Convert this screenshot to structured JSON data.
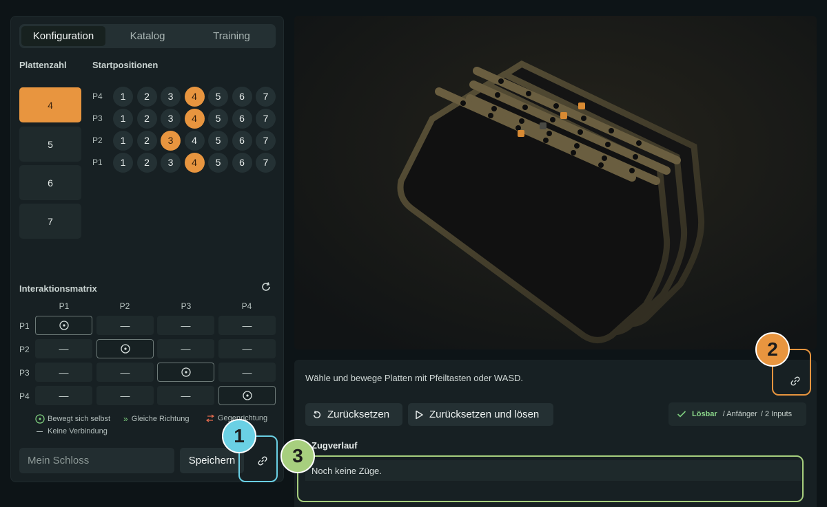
{
  "tabs": [
    "Konfiguration",
    "Katalog",
    "Training"
  ],
  "labels": {
    "plattenzahl": "Plattenzahl",
    "startpositionen": "Startpositionen",
    "interaktionsmatrix": "Interaktionsmatrix"
  },
  "plattenzahl": {
    "options": [
      "4",
      "5",
      "6",
      "7"
    ],
    "selected": "4"
  },
  "startpositionen": {
    "rows": [
      {
        "label": "P4",
        "values": [
          "1",
          "2",
          "3",
          "4",
          "5",
          "6",
          "7"
        ],
        "active": "4"
      },
      {
        "label": "P3",
        "values": [
          "1",
          "2",
          "3",
          "4",
          "5",
          "6",
          "7"
        ],
        "active": "4"
      },
      {
        "label": "P2",
        "values": [
          "1",
          "2",
          "3",
          "4",
          "5",
          "6",
          "7"
        ],
        "active": "3"
      },
      {
        "label": "P1",
        "values": [
          "1",
          "2",
          "3",
          "4",
          "5",
          "6",
          "7"
        ],
        "active": "4"
      }
    ]
  },
  "matrix": {
    "cols": [
      "P1",
      "P2",
      "P3",
      "P4"
    ],
    "rows": [
      "P1",
      "P2",
      "P3",
      "P4"
    ],
    "none_symbol": "—"
  },
  "legend": {
    "self": "Bewegt sich selbst",
    "same": "Gleiche Richtung",
    "opposite": "Gegenrichtung",
    "none": "Keine Verbindung"
  },
  "name_field": {
    "placeholder": "Mein Schloss",
    "value": ""
  },
  "save_label": "Speichern",
  "instructions": "Wähle und bewege Platten mit Pfeiltasten oder WASD.",
  "actions": {
    "reset": "Zurücksetzen",
    "reset_solve": "Zurücksetzen und lösen"
  },
  "status": {
    "solvable": "Lösbar",
    "level": "/ Anfänger",
    "inputs": "/ 2 Inputs"
  },
  "history": {
    "title": "Zugverlauf",
    "empty": "Noch keine Züge."
  },
  "annotations": {
    "badge1": "1",
    "badge2": "2",
    "badge3": "3"
  },
  "colors": {
    "accent": "#e8953f",
    "badge1": "#6ad0e4",
    "badge2": "#e8953f",
    "badge3": "#a7cf7e"
  }
}
